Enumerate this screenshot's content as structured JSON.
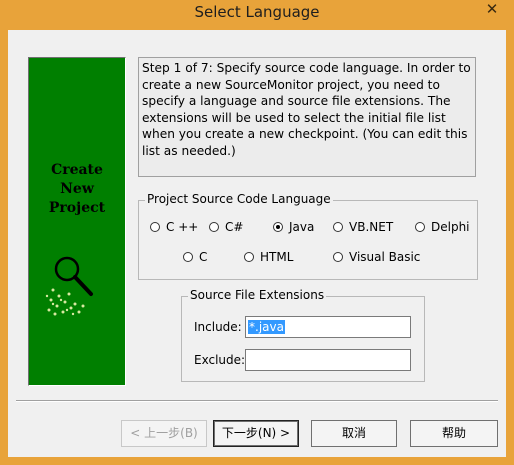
{
  "window": {
    "title": "Select Language",
    "close_glyph": "✕"
  },
  "side_panel": {
    "text_lines": [
      "Create",
      "New",
      "Project"
    ],
    "icon": "magnifier-icon"
  },
  "description": "Step 1 of 7: Specify source code language. In order to create a new SourceMonitor project, you need to specify a language and source file extensions. The extensions will be used to select the initial file list when you create a new checkpoint. (You can edit this list as needed.)",
  "language_group": {
    "label": "Project Source Code Language",
    "options": [
      {
        "label": "C ++",
        "selected": false
      },
      {
        "label": "C#",
        "selected": false
      },
      {
        "label": "Java",
        "selected": true
      },
      {
        "label": "VB.NET",
        "selected": false
      },
      {
        "label": "Delphi",
        "selected": false
      },
      {
        "label": "C",
        "selected": false
      },
      {
        "label": "HTML",
        "selected": false
      },
      {
        "label": "Visual Basic",
        "selected": false
      }
    ]
  },
  "extensions_group": {
    "label": "Source File Extensions",
    "include_label": "Include:",
    "include_value": "*.java",
    "exclude_label": "Exclude:",
    "exclude_value": ""
  },
  "buttons": {
    "back": "< 上一步(B)",
    "next": "下一步(N) >",
    "cancel": "取消",
    "help": "帮助"
  },
  "colors": {
    "title_bar": "#e8a33a",
    "side_panel": "#007f00",
    "selection": "#3399ff"
  }
}
